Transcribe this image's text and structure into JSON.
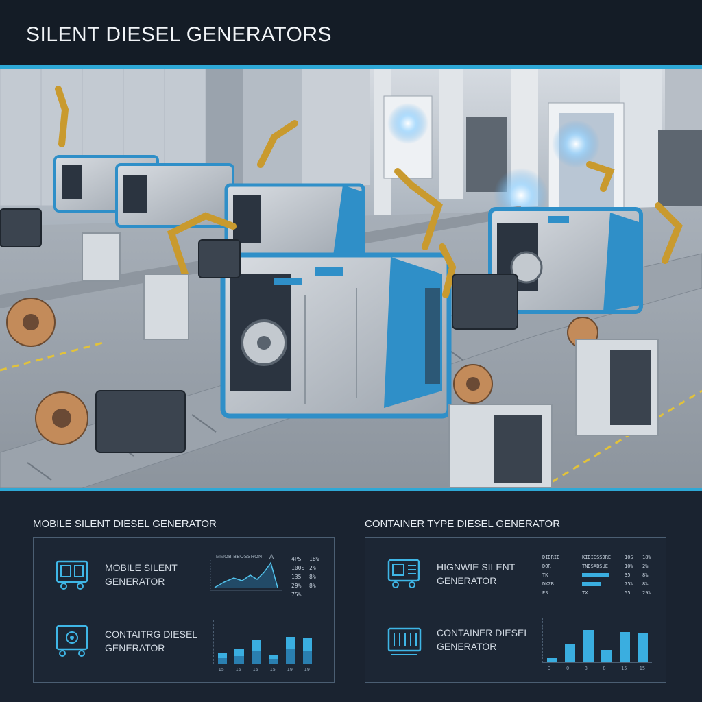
{
  "header": {
    "title": "SILENT DIESEL GENERATORS"
  },
  "left": {
    "section_title": "MOBILE SILENT DIESEL GENERATOR",
    "row1": {
      "line1": "MOBILE SILENT",
      "line2": "GENERATOR",
      "icon": "generator-icon"
    },
    "row2": {
      "line1": "CONTAITRG DIESEL",
      "line2": "GENERATOR",
      "icon": "diesel-engine-icon"
    },
    "line_chart": {
      "title": "MMOB BBOSSRON",
      "peak_label": "A",
      "stats": [
        [
          "4PS",
          "18%"
        ],
        [
          "100S",
          "2%"
        ],
        [
          "135",
          "8%"
        ],
        [
          "29%",
          "8%"
        ],
        [
          "75%",
          ""
        ]
      ]
    },
    "bar_chart": {
      "values": [
        0.26,
        0.35,
        0.56,
        0.2,
        0.62,
        0.58
      ],
      "values_front": [
        0.12,
        0.18,
        0.3,
        0.1,
        0.35,
        0.3
      ],
      "tick_labels": [
        "15",
        "15",
        "15",
        "15",
        "19",
        "19"
      ]
    }
  },
  "right": {
    "section_title": "CONTAINER TYPE DIESEL GENERATOR",
    "row1": {
      "line1": "HIGNWIE SILENT",
      "line2": "GENERATOR",
      "icon": "mobile-generator-icon"
    },
    "row2": {
      "line1": "CONTAINER DIESEL",
      "line2": "GENERATOR",
      "icon": "container-icon"
    },
    "table": {
      "col1": [
        "DIDRIE",
        "DOR",
        "TK",
        "DKZB",
        "ES"
      ],
      "col2": [
        "KIDIGSSDRE",
        "TNDSABSUE",
        "",
        "",
        "TX"
      ],
      "col3": [
        "10S",
        "10%",
        "35",
        "75%",
        "55"
      ],
      "col4": [
        "18%",
        "2%",
        "8%",
        "8%",
        "29%"
      ],
      "bars": [
        0.0,
        0.0,
        0.65,
        0.45,
        0.0
      ]
    },
    "bar_chart": {
      "values": [
        0.1,
        0.4,
        0.72,
        0.28,
        0.68,
        0.64
      ],
      "tick_labels": [
        "3",
        "0",
        "8",
        "8",
        "15",
        "15"
      ]
    }
  }
}
